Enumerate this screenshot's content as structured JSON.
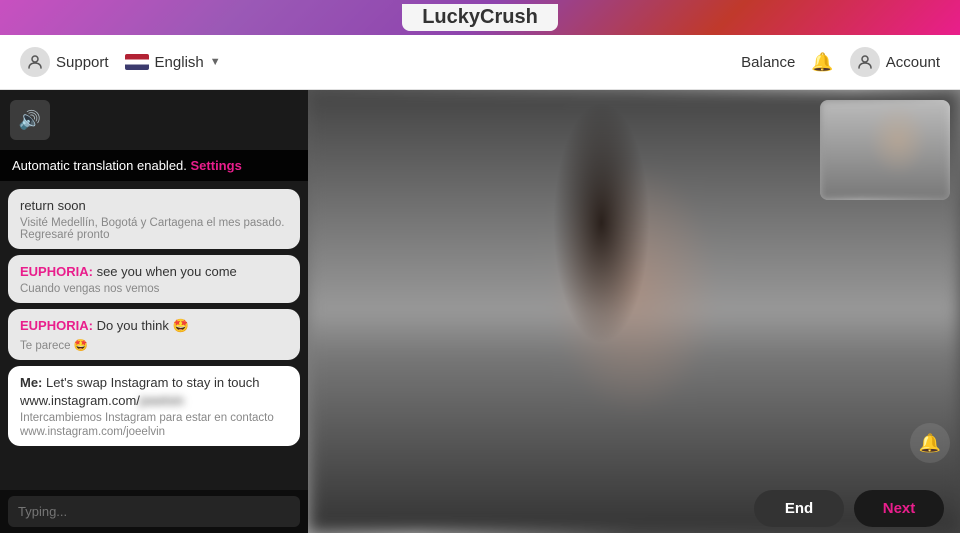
{
  "topbar": {
    "logo_plain": "Lucky",
    "logo_bold": "Crush"
  },
  "navbar": {
    "support_label": "Support",
    "language_label": "English",
    "balance_label": "Balance",
    "account_label": "Account"
  },
  "chat": {
    "translation_notice": "Automatic translation enabled.",
    "settings_label": "Settings",
    "messages": [
      {
        "id": 1,
        "sender": "other",
        "sender_label": "",
        "text": "return soon",
        "translated": "Visité Medellín, Bogotá y Cartagena el mes pasado. Regresaré pronto",
        "show_translation": true
      },
      {
        "id": 2,
        "sender": "euphoria",
        "sender_label": "EUPHORIA:",
        "text": "see you when you come",
        "translated": "Cuando vengas nos vemos",
        "show_translation": true
      },
      {
        "id": 3,
        "sender": "euphoria",
        "sender_label": "EUPHORIA:",
        "text": "Do you think 🤩",
        "translated": "Te parece 🤩",
        "show_translation": true
      },
      {
        "id": 4,
        "sender": "me",
        "sender_label": "Me:",
        "text": "Let's swap Instagram to stay in touch",
        "instagram_text": "www.instagram.com/",
        "instagram_blurred": "joeelvin",
        "translated": "Intercambiemos Instagram para estar en contacto",
        "translated2": "www.instagram.com/joeelvin",
        "show_translation": true
      }
    ],
    "input_placeholder": "Typing..."
  },
  "controls": {
    "end_label": "End",
    "next_label": "Next"
  }
}
